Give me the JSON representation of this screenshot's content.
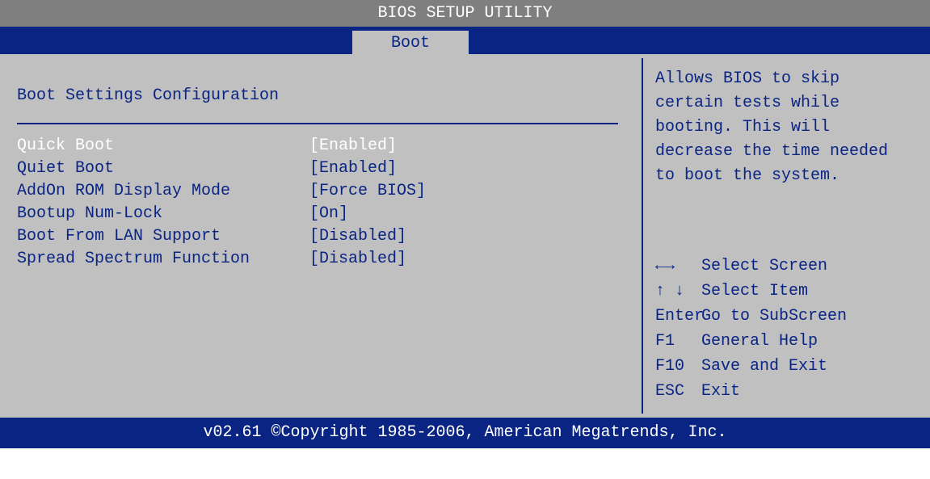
{
  "title": "BIOS SETUP UTILITY",
  "tabs": [
    {
      "label": "Boot",
      "active": true
    }
  ],
  "main": {
    "section_title": "Boot Settings Configuration",
    "settings": [
      {
        "label": "Quick Boot",
        "value": "[Enabled]",
        "selected": true
      },
      {
        "label": "Quiet Boot",
        "value": "[Enabled]"
      },
      {
        "label": "AddOn ROM Display Mode",
        "value": "[Force BIOS]"
      },
      {
        "label": "Bootup Num-Lock",
        "value": "[On]"
      },
      {
        "label": "Boot From LAN Support",
        "value": "[Disabled]"
      },
      {
        "label": "Spread Spectrum Function",
        "value": "[Disabled]"
      }
    ]
  },
  "help": {
    "text": "Allows BIOS to skip\ncertain tests while\nbooting. This will\ndecrease the time needed\nto boot the system.",
    "keys": [
      {
        "key": "←→",
        "description": "Select Screen"
      },
      {
        "key": "↑ ↓",
        "description": "Select Item"
      },
      {
        "key": "Enter",
        "description": "Go to SubScreen"
      },
      {
        "key": "F1",
        "description": "General Help"
      },
      {
        "key": "F10",
        "description": "Save and Exit"
      },
      {
        "key": "ESC",
        "description": "Exit"
      }
    ]
  },
  "footer": "v02.61 ©Copyright 1985-2006, American Megatrends, Inc.",
  "colors": {
    "title_bar": "#7f7f7f",
    "accent_blue": "#0a2484",
    "panel_gray": "#c0c0c0",
    "selected_text": "#ffffff"
  }
}
